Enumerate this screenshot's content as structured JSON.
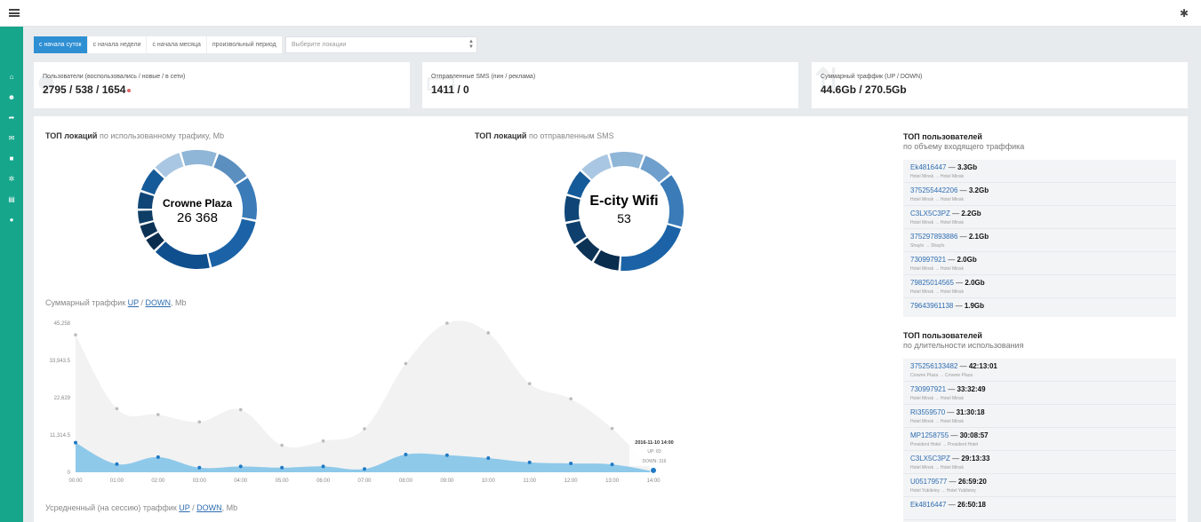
{
  "header": {
    "menu_icon": "hamburger-icon",
    "settings_icon": "gear-icon"
  },
  "sidebar": {
    "items": [
      {
        "icon": "home-icon",
        "glyph": "⌂"
      },
      {
        "icon": "users-icon",
        "glyph": "☻"
      },
      {
        "icon": "share-icon",
        "glyph": "➦"
      },
      {
        "icon": "mail-icon",
        "glyph": "✉"
      },
      {
        "icon": "lock-icon",
        "glyph": "■"
      },
      {
        "icon": "network-icon",
        "glyph": "✲"
      },
      {
        "icon": "document-icon",
        "glyph": "▤"
      },
      {
        "icon": "info-icon",
        "glyph": "●"
      }
    ]
  },
  "filters": {
    "buttons": [
      "с начала суток",
      "с начала недели",
      "с начала месяца",
      "произвольный период"
    ],
    "active_index": 0,
    "location_placeholder": "Выберите локации"
  },
  "cards": [
    {
      "label": "Пользователи (воспользовались / новые / в сети)",
      "value": "2795 / 538 / 1654",
      "icon": "user-icon"
    },
    {
      "label": "Отправленные SMS (пин / реклама)",
      "value": "1411 / 0",
      "icon": "sms-icon"
    },
    {
      "label": "Суммарный траффик (UP / DOWN)",
      "value": "44.6Gb / 270.5Gb",
      "icon": "traffic-icon"
    }
  ],
  "donut1": {
    "title_bold": "ТОП локаций",
    "title_rest": " по использованному трафику, Mb",
    "center_name": "Crowne Plaza",
    "center_value": "26 368"
  },
  "donut2": {
    "title_bold": "ТОП локаций",
    "title_rest": " по отправленным SMS",
    "center_name": "E-city Wifi",
    "center_value": "53"
  },
  "traffic_chart": {
    "title_prefix": "Суммарный траффик ",
    "up": "UP",
    "sep": " / ",
    "down": "DOWN",
    "suffix": ", Mb",
    "tooltip": {
      "title": "2016-11-10 14:00",
      "up": "UP: 83",
      "down": "DOWN: 316"
    }
  },
  "avg_chart": {
    "title_prefix": "Усредненный (на сессию) траффик ",
    "up": "UP",
    "sep": " / ",
    "down": "DOWN",
    "suffix": ", Mb"
  },
  "chart_data": {
    "type": "area",
    "x": [
      "00:00",
      "01:00",
      "02:00",
      "03:00",
      "04:00",
      "05:00",
      "06:00",
      "07:00",
      "08:00",
      "09:00",
      "10:00",
      "11:00",
      "12:00",
      "13:00",
      "14:00"
    ],
    "yticks": [
      "0",
      "11,314.5",
      "22,629",
      "33,943.5",
      "45,258"
    ],
    "ylim": [
      0,
      45258
    ],
    "series": [
      {
        "name": "UP",
        "color": "#8ec9ea",
        "values": [
          9000,
          2500,
          4600,
          1400,
          1800,
          1400,
          1800,
          1000,
          5400,
          5200,
          4300,
          3000,
          2700,
          2400,
          300
        ]
      },
      {
        "name": "DOWN",
        "color": "#f2f2f2",
        "values": [
          41700,
          19300,
          17500,
          15300,
          19000,
          8200,
          9500,
          13200,
          33000,
          45258,
          42300,
          26900,
          22300,
          13300,
          300
        ]
      }
    ]
  },
  "top_traffic": {
    "title": "ТОП пользователей",
    "subtitle": "по объему входящего траффика",
    "items": [
      {
        "user": "Ek4816447",
        "value": "3.3Gb",
        "location": "Hotel Minsk → Hotel Minsk"
      },
      {
        "user": "375255442206",
        "value": "3.2Gb",
        "location": "Hotel Minsk → Hotel Minsk"
      },
      {
        "user": "C3LX5C3PZ",
        "value": "2.2Gb",
        "location": "Hotel Minsk → Hotel Minsk"
      },
      {
        "user": "375297893886",
        "value": "2.1Gb",
        "location": "Shaylo → Shaylo"
      },
      {
        "user": "730997921",
        "value": "2.0Gb",
        "location": "Hotel Minsk → Hotel Minsk"
      },
      {
        "user": "79825014565",
        "value": "2.0Gb",
        "location": "Hotel Minsk → Hotel Minsk"
      },
      {
        "user": "79643961138",
        "value": "1.9Gb",
        "location": ""
      }
    ]
  },
  "top_duration": {
    "title": "ТОП пользователей",
    "subtitle": "по длительности использования",
    "items": [
      {
        "user": "375256133482",
        "value": "42:13:01",
        "location": "Crowne Plaza → Crowne Plaza"
      },
      {
        "user": "730997921",
        "value": "33:32:49",
        "location": "Hotel Minsk → Hotel Minsk"
      },
      {
        "user": "RI3559570",
        "value": "31:30:18",
        "location": "Hotel Minsk → Hotel Minsk"
      },
      {
        "user": "MP1258755",
        "value": "30:08:57",
        "location": "President Hotel → President Hotel"
      },
      {
        "user": "C3LX5C3PZ",
        "value": "29:13:33",
        "location": "Hotel Minsk → Hotel Minsk"
      },
      {
        "user": "U05179577",
        "value": "26:59:20",
        "location": "Hotel Yubileiny → Hotel Yubileiny"
      },
      {
        "user": "Ek4816447",
        "value": "26:50:18",
        "location": ""
      }
    ]
  }
}
